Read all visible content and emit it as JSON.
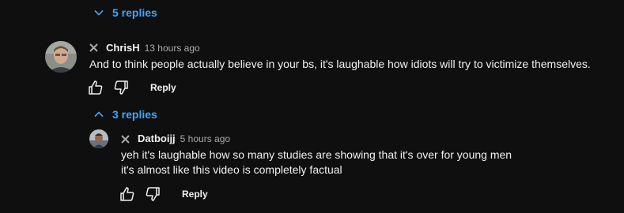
{
  "colors": {
    "background": "#0f0f0f",
    "text": "#f1f1f1",
    "muted": "#aaaaaa",
    "link": "#3ea6ff"
  },
  "top_toggle": {
    "icon": "chevron-down-icon",
    "label": "5 replies"
  },
  "comment": {
    "avatar": "avatar",
    "remove_icon": "close-icon",
    "author": "ChrisH",
    "timestamp": "13 hours ago",
    "text": "And to think people actually believe in your bs, it's laughable how idiots will try to victimize themselves.",
    "like_icon": "thumbs-up-icon",
    "dislike_icon": "thumbs-down-icon",
    "reply_label": "Reply",
    "replies_toggle": {
      "icon": "chevron-up-icon",
      "label": "3 replies"
    }
  },
  "reply": {
    "avatar": "avatar",
    "remove_icon": "close-icon",
    "author": "Datboijj",
    "timestamp": "5 hours ago",
    "lines": [
      "yeh it's laughable how so many studies are showing that it's over for young men",
      "it's almost like this video is completely factual"
    ],
    "like_icon": "thumbs-up-icon",
    "dislike_icon": "thumbs-down-icon",
    "reply_label": "Reply"
  }
}
